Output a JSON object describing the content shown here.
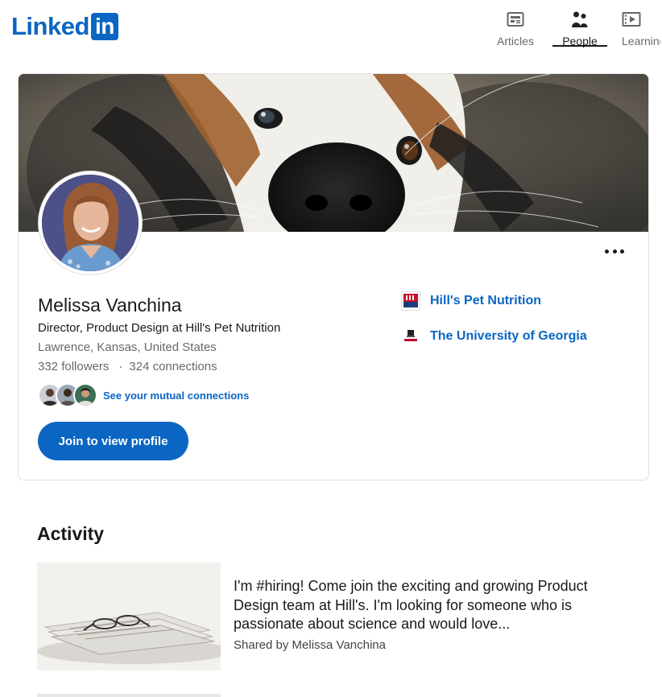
{
  "header": {
    "logo": {
      "text": "Linked",
      "box": "in"
    },
    "nav": [
      {
        "label": "Articles",
        "icon": "articles-icon",
        "active": false
      },
      {
        "label": "People",
        "icon": "people-icon",
        "active": true
      },
      {
        "label": "Learning",
        "icon": "learning-icon",
        "active": false
      }
    ]
  },
  "profile": {
    "name": "Melissa Vanchina",
    "headline": "Director, Product Design at Hill's Pet Nutrition",
    "location": "Lawrence, Kansas, United States",
    "followers": "332 followers",
    "connections_separator": "·",
    "connections": "324 connections",
    "mutual_link": "See your mutual connections",
    "join_button": "Join to view profile",
    "more_icon": "more-horizontal-icon",
    "organizations": [
      {
        "label": "Hill's Pet Nutrition",
        "icon": "hills-logo-icon"
      },
      {
        "label": "The University of Georgia",
        "icon": "uga-logo-icon"
      }
    ]
  },
  "activity": {
    "title": "Activity",
    "items": [
      {
        "text": "I'm #hiring! Come join the exciting and growing Product Design team at Hill's. I'm looking for someone who is passionate about science and would love...",
        "meta": "Shared by Melissa Vanchina"
      }
    ]
  },
  "colors": {
    "brand": "#0a66c2",
    "text_primary": "#000000e6",
    "text_secondary": "#00000099",
    "border": "#e0dfdc"
  }
}
